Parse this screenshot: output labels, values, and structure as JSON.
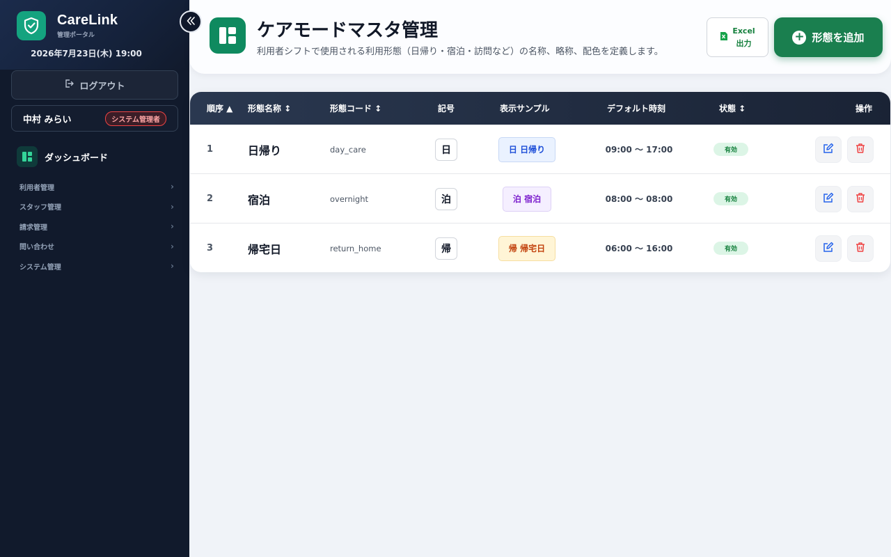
{
  "sidebar": {
    "brand_name": "CareLink",
    "brand_sub": "管理ポータル",
    "datetime": "2026年7月23日(木) 19:00",
    "logout_label": "ログアウト",
    "user_name": "中村 みらい",
    "role": "システム管理者",
    "dashboard_label": "ダッシュボード",
    "items": [
      {
        "label": "利用者管理"
      },
      {
        "label": "スタッフ管理"
      },
      {
        "label": "請求管理"
      },
      {
        "label": "問い合わせ"
      },
      {
        "label": "システム管理"
      }
    ]
  },
  "header": {
    "title": "ケアモードマスタ管理",
    "subtitle": "利用者シフトで使用される利用形態（日帰り・宿泊・訪問など）の名称、略称、配色を定義します。",
    "excel_line1": "Excel",
    "excel_line2": "出力",
    "add_label": "形態を追加"
  },
  "table": {
    "headers": {
      "order": "順序 ▲",
      "name": "形態名称 ↕",
      "code": "形態コード ↕",
      "symbol": "記号",
      "sample": "表示サンプル",
      "time": "デフォルト時刻",
      "status": "状態 ↕",
      "actions": "操作"
    },
    "rows": [
      {
        "order": "1",
        "name": "日帰り",
        "code": "day_care",
        "symbol": "日",
        "sample": "日 日帰り",
        "sample_bg": "#eaf2ff",
        "sample_border": "#c7d8f5",
        "sample_color": "#1d4ed8",
        "time": "09:00 〜 17:00",
        "status": "有効"
      },
      {
        "order": "2",
        "name": "宿泊",
        "code": "overnight",
        "symbol": "泊",
        "sample": "泊 宿泊",
        "sample_bg": "#f5efff",
        "sample_border": "#ddd0f6",
        "sample_color": "#7e22ce",
        "time": "08:00 〜 08:00",
        "status": "有効"
      },
      {
        "order": "3",
        "name": "帰宅日",
        "code": "return_home",
        "symbol": "帰",
        "sample": "帰 帰宅日",
        "sample_bg": "#fff5d6",
        "sample_border": "#f6dea0",
        "sample_color": "#c2410c",
        "time": "06:00 〜 16:00",
        "status": "有効"
      }
    ]
  }
}
